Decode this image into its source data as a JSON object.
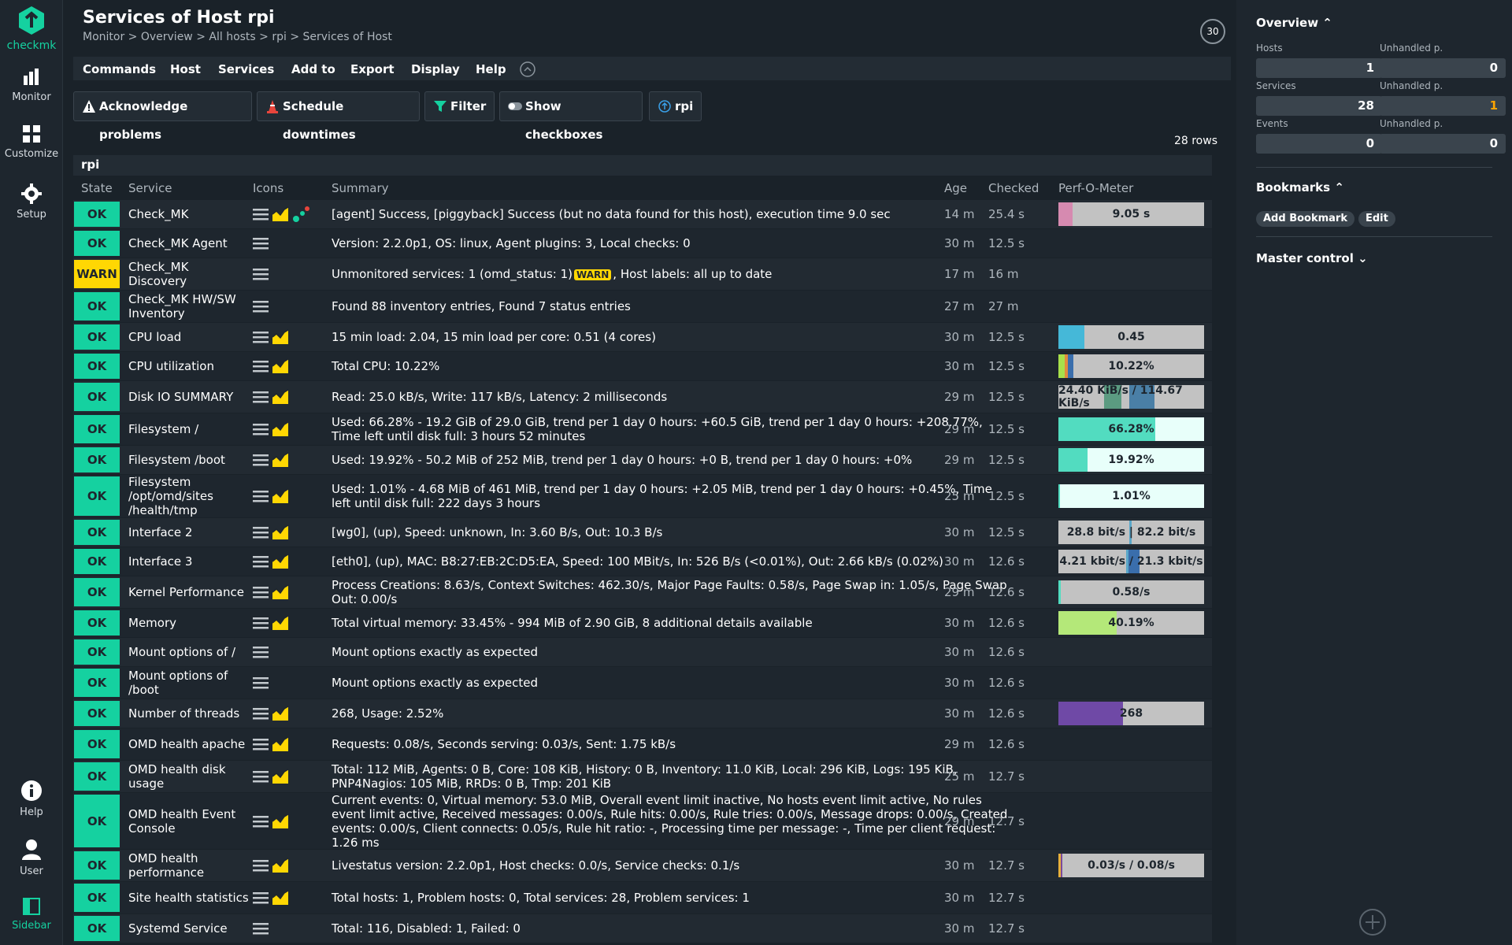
{
  "nav": {
    "brand": "checkmk",
    "monitor": "Monitor",
    "customize": "Customize",
    "setup": "Setup",
    "help": "Help",
    "user": "User",
    "sidebar": "Sidebar"
  },
  "header": {
    "title": "Services of Host rpi",
    "breadcrumb": "Monitor > Overview > All hosts > rpi > Services of Host",
    "refresh": "30"
  },
  "menu": [
    "Commands",
    "Host",
    "Services",
    "Add to",
    "Export",
    "Display",
    "Help"
  ],
  "toolbar": {
    "ack": "Acknowledge problems",
    "downtime": "Schedule downtimes",
    "filter": "Filter",
    "checkboxes": "Show checkboxes",
    "host": "rpi"
  },
  "rowcount": "28 rows",
  "table": {
    "group": "rpi",
    "headers": {
      "state": "State",
      "service": "Service",
      "icons": "Icons",
      "summary": "Summary",
      "age": "Age",
      "checked": "Checked",
      "perf": "Perf-O-Meter"
    },
    "rows": [
      {
        "state": "OK",
        "service": "Check_MK",
        "summary": "[agent] Success, [piggyback] Success (but no data found for this host), execution time 9.0 sec",
        "age": "14 m",
        "checked": "25.4 s",
        "perf": "9.05 s"
      },
      {
        "state": "OK",
        "service": "Check_MK Agent",
        "summary": "Version: 2.2.0p1, OS: linux, Agent plugins: 3, Local checks: 0",
        "age": "30 m",
        "checked": "12.5 s",
        "perf": ""
      },
      {
        "state": "WARN",
        "service": "Check_MK Discovery",
        "summary_pre": "Unmonitored services: 1 (omd_status: 1)",
        "summary_badge": "WARN",
        "summary_post": ", Host labels: all up to date",
        "age": "17 m",
        "checked": "16 m",
        "perf": ""
      },
      {
        "state": "OK",
        "service": "Check_MK HW/SW Inventory",
        "summary": "Found 88 inventory entries, Found 7 status entries",
        "age": "27 m",
        "checked": "27 m",
        "perf": ""
      },
      {
        "state": "OK",
        "service": "CPU load",
        "summary": "15 min load: 2.04, 15 min load per core: 0.51 (4 cores)",
        "age": "30 m",
        "checked": "12.5 s",
        "perf": "0.45"
      },
      {
        "state": "OK",
        "service": "CPU utilization",
        "summary": "Total CPU: 10.22%",
        "age": "30 m",
        "checked": "12.5 s",
        "perf": "10.22%"
      },
      {
        "state": "OK",
        "service": "Disk IO SUMMARY",
        "summary": "Read: 25.0 kB/s, Write: 117 kB/s, Latency: 2 milliseconds",
        "age": "29 m",
        "checked": "12.5 s",
        "perf": "24.40 KiB/s / 114.67 KiB/s"
      },
      {
        "state": "OK",
        "service": "Filesystem /",
        "summary": "Used: 66.28% - 19.2 GiB of 29.0 GiB, trend per 1 day 0 hours: +60.5 GiB, trend per 1 day 0 hours: +208.77%, Time left until disk full: 3 hours 52 minutes",
        "age": "29 m",
        "checked": "12.5 s",
        "perf": "66.28%"
      },
      {
        "state": "OK",
        "service": "Filesystem /boot",
        "summary": "Used: 19.92% - 50.2 MiB of 252 MiB, trend per 1 day 0 hours: +0 B, trend per 1 day 0 hours: +0%",
        "age": "29 m",
        "checked": "12.5 s",
        "perf": "19.92%"
      },
      {
        "state": "OK",
        "service": "Filesystem /opt/omd/sites /health/tmp",
        "summary": "Used: 1.01% - 4.68 MiB of 461 MiB, trend per 1 day 0 hours: +2.05 MiB, trend per 1 day 0 hours: +0.45%, Time left until disk full: 222 days 3 hours",
        "age": "25 m",
        "checked": "12.5 s",
        "perf": "1.01%"
      },
      {
        "state": "OK",
        "service": "Interface 2",
        "summary": "[wg0], (up), Speed: unknown, In: 3.60 B/s, Out: 10.3 B/s",
        "age": "30 m",
        "checked": "12.5 s",
        "perf": "28.8 bit/s | 82.2 bit/s"
      },
      {
        "state": "OK",
        "service": "Interface 3",
        "summary": "[eth0], (up), MAC: B8:27:EB:2C:D5:EA, Speed: 100 MBit/s, In: 526 B/s (<0.01%), Out: 2.66 kB/s (0.02%)",
        "age": "30 m",
        "checked": "12.6 s",
        "perf": "4.21 kbit/s / 21.3 kbit/s"
      },
      {
        "state": "OK",
        "service": "Kernel Performance",
        "summary": "Process Creations: 8.63/s, Context Switches: 462.30/s, Major Page Faults: 0.58/s, Page Swap in: 1.05/s, Page Swap Out: 0.00/s",
        "age": "29 m",
        "checked": "12.6 s",
        "perf": "0.58/s"
      },
      {
        "state": "OK",
        "service": "Memory",
        "summary": "Total virtual memory: 33.45% - 994 MiB of 2.90 GiB, 8 additional details available",
        "age": "30 m",
        "checked": "12.6 s",
        "perf": "40.19%"
      },
      {
        "state": "OK",
        "service": "Mount options of /",
        "summary": "Mount options exactly as expected",
        "age": "30 m",
        "checked": "12.6 s",
        "perf": ""
      },
      {
        "state": "OK",
        "service": "Mount options of /boot",
        "summary": "Mount options exactly as expected",
        "age": "30 m",
        "checked": "12.6 s",
        "perf": ""
      },
      {
        "state": "OK",
        "service": "Number of threads",
        "summary": "268, Usage: 2.52%",
        "age": "30 m",
        "checked": "12.6 s",
        "perf": "268"
      },
      {
        "state": "OK",
        "service": "OMD health apache",
        "summary": "Requests: 0.08/s, Seconds serving: 0.03/s, Sent: 1.75 kB/s",
        "age": "29 m",
        "checked": "12.6 s",
        "perf": ""
      },
      {
        "state": "OK",
        "service": "OMD health disk usage",
        "summary": "Total: 112 MiB, Agents: 0 B, Core: 108 KiB, History: 0 B, Inventory: 11.0 KiB, Local: 296 KiB, Logs: 195 KiB, PNP4Nagios: 105 MiB, RRDs: 0 B, Tmp: 201 KiB",
        "age": "25 m",
        "checked": "12.7 s",
        "perf": ""
      },
      {
        "state": "OK",
        "service": "OMD health Event Console",
        "summary": "Current events: 0, Virtual memory: 53.0 MiB, Overall event limit inactive, No hosts event limit active, No rules event limit active, Received messages: 0.00/s, Rule hits: 0.00/s, Rule tries: 0.00/s, Message drops: 0.00/s, Created events: 0.00/s, Client connects: 0.05/s, Rule hit ratio: -, Processing time per message: -, Time per client request: 1.26 ms",
        "age": "29 m",
        "checked": "12.7 s",
        "perf": ""
      },
      {
        "state": "OK",
        "service": "OMD health performance",
        "summary": "Livestatus version: 2.2.0p1, Host checks: 0.0/s, Service checks: 0.1/s",
        "age": "30 m",
        "checked": "12.7 s",
        "perf": "0.03/s / 0.08/s"
      },
      {
        "state": "OK",
        "service": "Site health statistics",
        "summary": "Total hosts: 1, Problem hosts: 0, Total services: 28, Problem services: 1",
        "age": "30 m",
        "checked": "12.7 s",
        "perf": ""
      },
      {
        "state": "OK",
        "service": "Systemd Service",
        "summary": "Total: 116, Disabled: 1, Failed: 0",
        "age": "30 m",
        "checked": "12.7 s",
        "perf": ""
      }
    ]
  },
  "sidebar": {
    "overview": "Overview",
    "hosts": "Hosts",
    "hosts_val": "1",
    "hosts_unh": "Unhandled p.",
    "hosts_unh_val": "0",
    "services": "Services",
    "services_val": "28",
    "services_unh": "Unhandled p.",
    "services_unh_val": "1",
    "events": "Events",
    "events_val": "0",
    "events_unh": "Unhandled p.",
    "events_unh_val": "0",
    "bookmarks": "Bookmarks",
    "add_bookmark": "Add Bookmark",
    "edit": "Edit",
    "master_control": "Master control"
  },
  "colors": {
    "ok": "#15d1a0",
    "warn": "#ffd703",
    "accent": "#15d1a0"
  }
}
